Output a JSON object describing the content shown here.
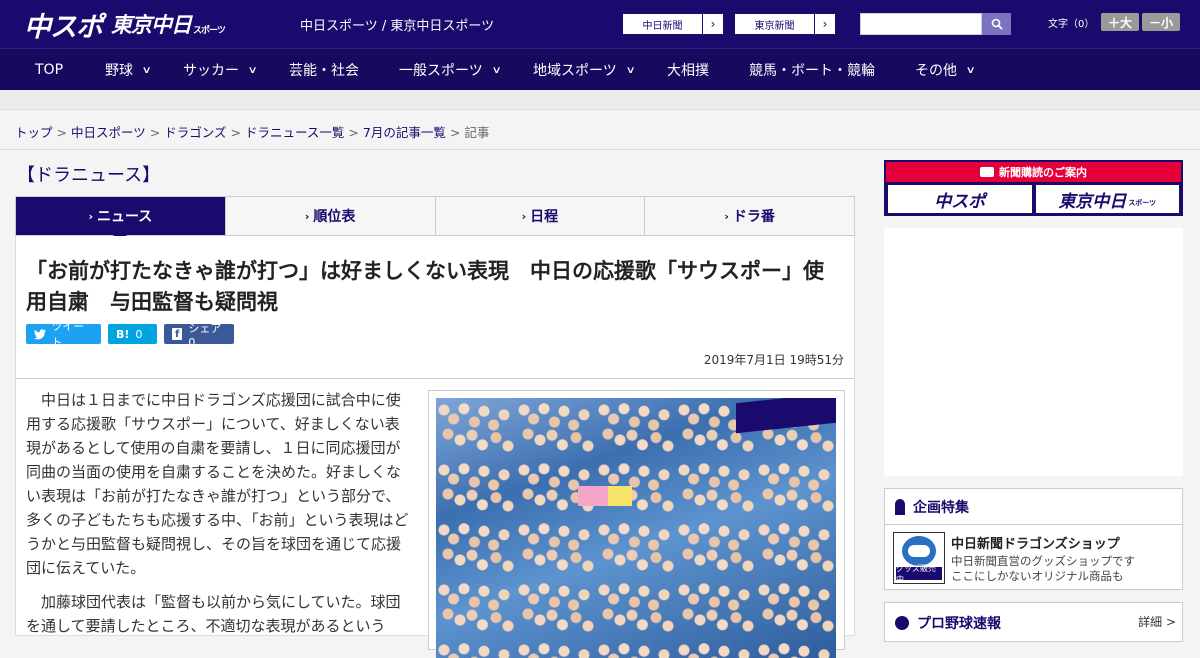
{
  "header": {
    "logo_chuspo": "中スポ",
    "logo_tokyo": "東京中日",
    "logo_tokyo_small": "スポーツ",
    "site_name": "中日スポーツ / 東京中日スポーツ",
    "paper_links": [
      {
        "label": "中日新聞",
        "arrow": "›"
      },
      {
        "label": "東京新聞",
        "arrow": "›"
      }
    ],
    "search_placeholder": "",
    "font_size_label": "文字（0）",
    "font_larger": "＋大",
    "font_smaller": "－小"
  },
  "nav": {
    "items": [
      {
        "label": "TOP",
        "dropdown": false
      },
      {
        "label": "野球",
        "dropdown": true
      },
      {
        "label": "サッカー",
        "dropdown": true
      },
      {
        "label": "芸能・社会",
        "dropdown": false
      },
      {
        "label": "一般スポーツ",
        "dropdown": true
      },
      {
        "label": "地域スポーツ",
        "dropdown": true
      },
      {
        "label": "大相撲",
        "dropdown": false
      },
      {
        "label": "競馬・ボート・競輪",
        "dropdown": false
      },
      {
        "label": "その他",
        "dropdown": true
      }
    ]
  },
  "breadcrumb": {
    "items": [
      "トップ",
      "中日スポーツ",
      "ドラゴンズ",
      "ドラニュース一覧",
      "7月の記事一覧"
    ],
    "current": "記事",
    "separator": ">"
  },
  "section_title": "【ドラニュース】",
  "tabs": [
    {
      "label": "ニュース",
      "active": true
    },
    {
      "label": "順位表",
      "active": false
    },
    {
      "label": "日程",
      "active": false
    },
    {
      "label": "ドラ番",
      "active": false
    }
  ],
  "article": {
    "headline": "「お前が打たなきゃ誰が打つ」は好ましくない表現　中日の応援歌「サウスポー」使用自粛　与田監督も疑問視",
    "share": {
      "tweet": "ツイート",
      "hatena_icon": "B!",
      "hatena_count": "0",
      "facebook_icon": "f",
      "facebook_label": "シェア 0"
    },
    "date": "2019年7月1日 19時51分",
    "paragraphs": [
      "中日は１日までに中日ドラゴンズ応援団に試合中に使用する応援歌「サウスポー」について、好ましくない表現があるとして使用の自粛を要請し、１日に同応援団が同曲の当面の使用を自粛することを決めた。好ましくない表現は「お前が打たなきゃ誰が打つ」という部分で、多くの子どもたちも応援する中、「お前」という表現はどうかと与田監督も疑問視し、その旨を球団を通じて応援団に伝えていた。",
      "加藤球団代表は「監督も以前から気にしていた。球団を通して要請したところ、不適切な表現があるという"
    ]
  },
  "sidebar": {
    "subscription_title": "新聞購読のご案内",
    "sub_logo_1": "中スポ",
    "sub_logo_2": "東京中日",
    "sub_logo_2_small": "スポーツ",
    "feature_title": "企画特集",
    "shop_title": "中日新聞ドラゴンズショップ",
    "shop_desc_1": "中日新聞直営のグッズショップです",
    "shop_desc_2": "ここにしかないオリジナル商品も",
    "shop_thumb_tag": "グッズ販売中",
    "baseball_title": "プロ野球速報",
    "baseball_more": "詳細 >"
  },
  "colors": {
    "brand_navy": "#1a0a6e",
    "nav_bg": "#150a5e",
    "twitter": "#1da1f2",
    "hatena": "#00a4de",
    "facebook": "#3b5998",
    "subscription_red": "#e60039"
  }
}
